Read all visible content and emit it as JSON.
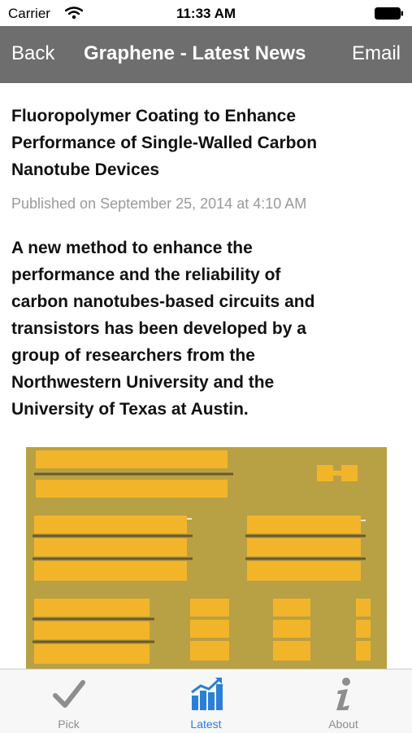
{
  "status_bar": {
    "carrier": "Carrier",
    "time": "11:33 AM",
    "wifi_icon": "wifi-icon",
    "battery_icon": "battery-icon"
  },
  "nav": {
    "back_label": "Back",
    "title": "Graphene - Latest News",
    "email_label": "Email",
    "background": "#6e6e6e"
  },
  "article": {
    "title_lines": [
      "Fluoropolymer Coating to Enhance",
      "Performance of Single-Walled Carbon",
      "Nanotube Devices"
    ],
    "published": "Published on September 25, 2014 at 4:10 AM",
    "lead_lines": [
      "A new method to enhance the",
      "performance and the reliability of",
      "carbon nanotubes-based circuits and",
      "transistors has been developed by a",
      "group of researchers from the",
      "Northwestern University and the",
      "University of Texas at Austin."
    ],
    "image_subject": "micrograph of gold electrode pads on a chip"
  },
  "tabs": [
    {
      "label": "Pick",
      "icon": "checkmark-icon",
      "active": false
    },
    {
      "label": "Latest",
      "icon": "bar-chart-icon",
      "active": true
    },
    {
      "label": "About",
      "icon": "info-icon",
      "active": false
    }
  ],
  "colors": {
    "tab_active": "#2b7fd6",
    "tab_inactive": "#8e8e8e",
    "pad_gold": "#f2b52a",
    "substrate": "#b69a40"
  }
}
